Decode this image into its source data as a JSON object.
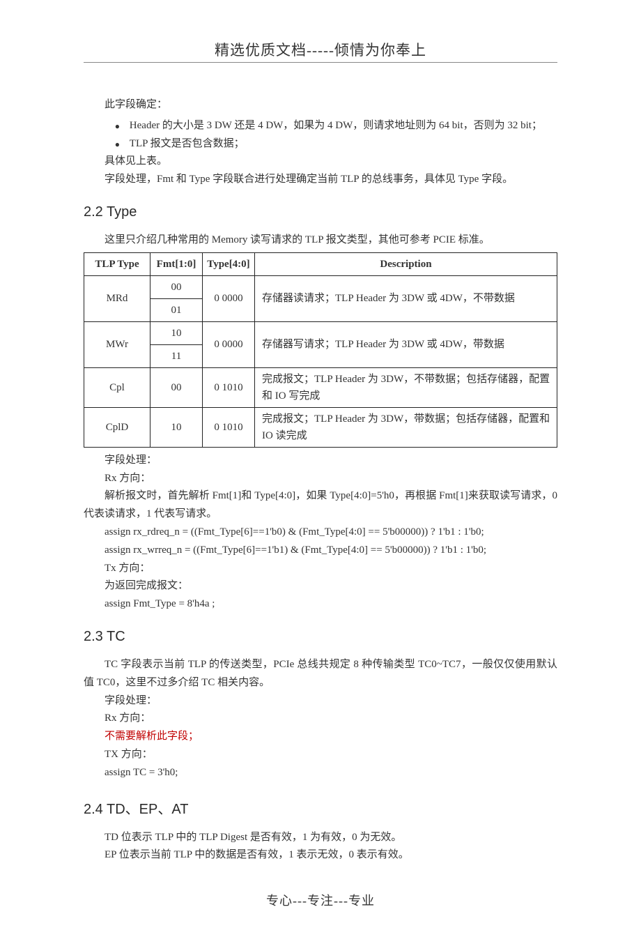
{
  "header": {
    "title": "精选优质文档-----倾情为你奉上"
  },
  "sections": {
    "s21_intro": "此字段确定：",
    "s21_bullets": [
      "Header 的大小是 3 DW 还是 4 DW，如果为 4 DW，则请求地址则为 64 bit，否则为 32 bit；",
      "TLP 报文是否包含数据；"
    ],
    "s21_after1": "具体见上表。",
    "s21_after2": "字段处理，Fmt 和 Type 字段联合进行处理确定当前 TLP 的总线事务，具体见 Type 字段。",
    "s22_title": "2.2  Type",
    "s22_intro": "这里只介绍几种常用的 Memory 读写请求的 TLP 报文类型，其他可参考 PCIE 标准。",
    "table": {
      "headers": [
        "TLP Type",
        "Fmt[1:0]",
        "Type[4:0]",
        "Description"
      ],
      "rows": [
        {
          "tlp": "MRd",
          "fmt": "00",
          "type": "0 0000",
          "desc": "存储器读请求；TLP Header 为 3DW 或 4DW，不带数据"
        },
        {
          "tlp": "",
          "fmt": "01",
          "type": "",
          "desc": ""
        },
        {
          "tlp": "MWr",
          "fmt": "10",
          "type": "0 0000",
          "desc": "存储器写请求；TLP Header 为 3DW 或 4DW，带数据"
        },
        {
          "tlp": "",
          "fmt": "11",
          "type": "",
          "desc": ""
        },
        {
          "tlp": "Cpl",
          "fmt": "00",
          "type": "0 1010",
          "desc": "完成报文；TLP Header 为 3DW，不带数据；包括存储器，配置和 IO 写完成"
        },
        {
          "tlp": "CplD",
          "fmt": "10",
          "type": "0 1010",
          "desc": "完成报文；TLP Header 为 3DW，带数据；包括存储器，配置和 IO 读完成"
        }
      ]
    },
    "s22_after": {
      "l1": "字段处理：",
      "l2": "Rx 方向：",
      "l3": "解析报文时，首先解析 Fmt[1]和 Type[4:0]，如果 Type[4:0]=5'h0，再根据 Fmt[1]来获取读写请求，0 代表读请求，1 代表写请求。",
      "l4": "assign rx_rdreq_n = ((Fmt_Type[6]==1'b0) & (Fmt_Type[4:0] == 5'b00000)) ? 1'b1 : 1'b0;",
      "l5": "assign rx_wrreq_n = ((Fmt_Type[6]==1'b1) & (Fmt_Type[4:0] == 5'b00000)) ? 1'b1 : 1'b0;",
      "l6": "Tx 方向：",
      "l7": "为返回完成报文：",
      "l8": "assign Fmt_Type = 8'h4a ;"
    },
    "s23_title": "2.3  TC",
    "s23": {
      "p1": "TC 字段表示当前 TLP 的传送类型，PCIe 总线共规定 8 种传输类型 TC0~TC7，一般仅仅使用默认值 TC0，这里不过多介绍 TC 相关内容。",
      "l1": "字段处理：",
      "l2": "Rx 方向：",
      "l3": "不需要解析此字段；",
      "l4": "TX 方向：",
      "l5": "assign TC = 3'h0;"
    },
    "s24_title": "2.4  TD、EP、AT",
    "s24": {
      "l1": "TD 位表示 TLP 中的 TLP Digest 是否有效，1 为有效，0 为无效。",
      "l2": "EP 位表示当前 TLP 中的数据是否有效，1 表示无效，0 表示有效。"
    }
  },
  "footer": "专心---专注---专业"
}
